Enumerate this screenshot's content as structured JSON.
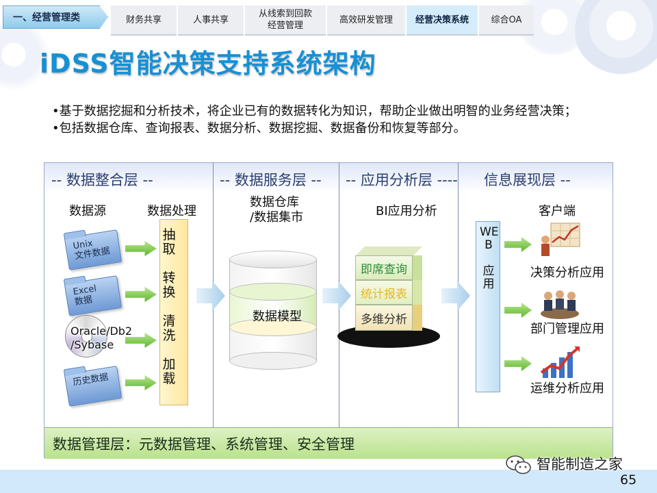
{
  "nav": {
    "current": "一、经营管理类",
    "tabs": [
      {
        "label": "财务共享",
        "active": false
      },
      {
        "label": "人事共享",
        "active": false
      },
      {
        "label": "从线索到回款\n经营管理",
        "active": false
      },
      {
        "label": "高效研发管理",
        "active": false
      },
      {
        "label": "经营决策系统",
        "active": true
      },
      {
        "label": "综合OA",
        "active": false
      }
    ]
  },
  "title": "iDSS智能决策支持系统架构",
  "bullets": [
    "•基于数据挖掘和分析技术，将企业已有的数据转化为知识，帮助企业做出明智的业务经营决策；",
    "•包括数据仓库、查询报表、数据分析、数据挖掘、数据备份和恢复等部分。"
  ],
  "diagram": {
    "layers": [
      "-- 数据整合层 --",
      "-- 数据服务层 --",
      "-- 应用分析层 ----",
      "信息展现层 --"
    ],
    "sources": {
      "label": "数据源",
      "items": [
        "Unix\n文件数据",
        "Excel\n数据",
        "Oracle/Db2\n/Sybase",
        "历史数据"
      ]
    },
    "processing": {
      "label": "数据处理",
      "steps": "抽\n取\n\n转\n换\n\n清\n洗\n\n加\n载"
    },
    "warehouse": {
      "label": "数据仓库\n/数据集市",
      "model": "数据模型"
    },
    "bi": {
      "label": "BI应用分析",
      "items": [
        "即席查询",
        "统计报表",
        "多维分析"
      ]
    },
    "web": "WE\nB\n\n应\n用",
    "client": {
      "label": "客户端",
      "apps": [
        "决策分析应用",
        "部门管理应用",
        "运维分析应用"
      ]
    },
    "management": "数据管理层：元数据管理、系统管理、安全管理"
  },
  "watermark": "智能制造之家",
  "page_number": "65",
  "colors": {
    "title": "#1790d4",
    "header_text": "#2c3f6e",
    "management_band": "#c8e8a4",
    "bi_query": "#2c8c3c",
    "bi_report": "#e8b820",
    "footer_band": "#d2e9fb"
  }
}
